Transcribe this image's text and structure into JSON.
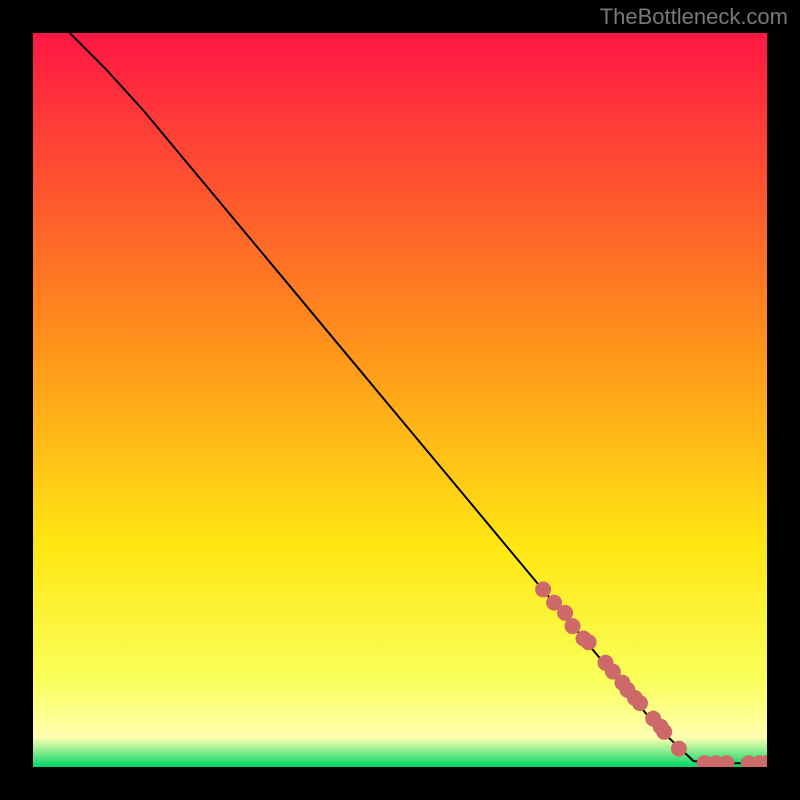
{
  "attribution": "TheBottleneck.com",
  "chart_data": {
    "type": "line",
    "title": "",
    "xlabel": "",
    "ylabel": "",
    "xlim": [
      0,
      100
    ],
    "ylim": [
      0,
      100
    ],
    "background": "rainbow-gradient-red-yellow-green",
    "curve": {
      "description": "Decreasing curve from top-left to bottom-right, flattening near bottom",
      "x": [
        5,
        7,
        10,
        15,
        20,
        25,
        30,
        35,
        40,
        45,
        50,
        55,
        60,
        65,
        70,
        75,
        80,
        85,
        90,
        95,
        100
      ],
      "y": [
        100,
        98,
        95,
        89.5,
        83.5,
        77.5,
        71.5,
        65.5,
        59.5,
        53.5,
        47.5,
        41.5,
        35.5,
        29.5,
        23.5,
        17.5,
        11.5,
        5.5,
        0.8,
        0.5,
        0.5
      ]
    },
    "dots": {
      "color": "#cd6a69",
      "radius_px": 8,
      "x": [
        69.5,
        71,
        72.5,
        73.5,
        75,
        75.7,
        78,
        79,
        80.3,
        81,
        82,
        82.7,
        84.5,
        85.5,
        86,
        88,
        91.5,
        93,
        94.5,
        97.5,
        99,
        100
      ],
      "y": [
        24.2,
        22.4,
        21,
        19.2,
        17.5,
        17,
        14.2,
        13,
        11.5,
        10.5,
        9.4,
        8.7,
        6.6,
        5.5,
        4.8,
        2.5,
        0.5,
        0.5,
        0.5,
        0.5,
        0.5,
        0.5
      ]
    },
    "gradient_colors": {
      "top": "#ff1744",
      "upper_mid": "#ff8b1c",
      "mid": "#ffe712",
      "lower_mid": "#f9ff5a",
      "near_bottom": "#ffffb0",
      "bottom": "#00d665"
    }
  }
}
